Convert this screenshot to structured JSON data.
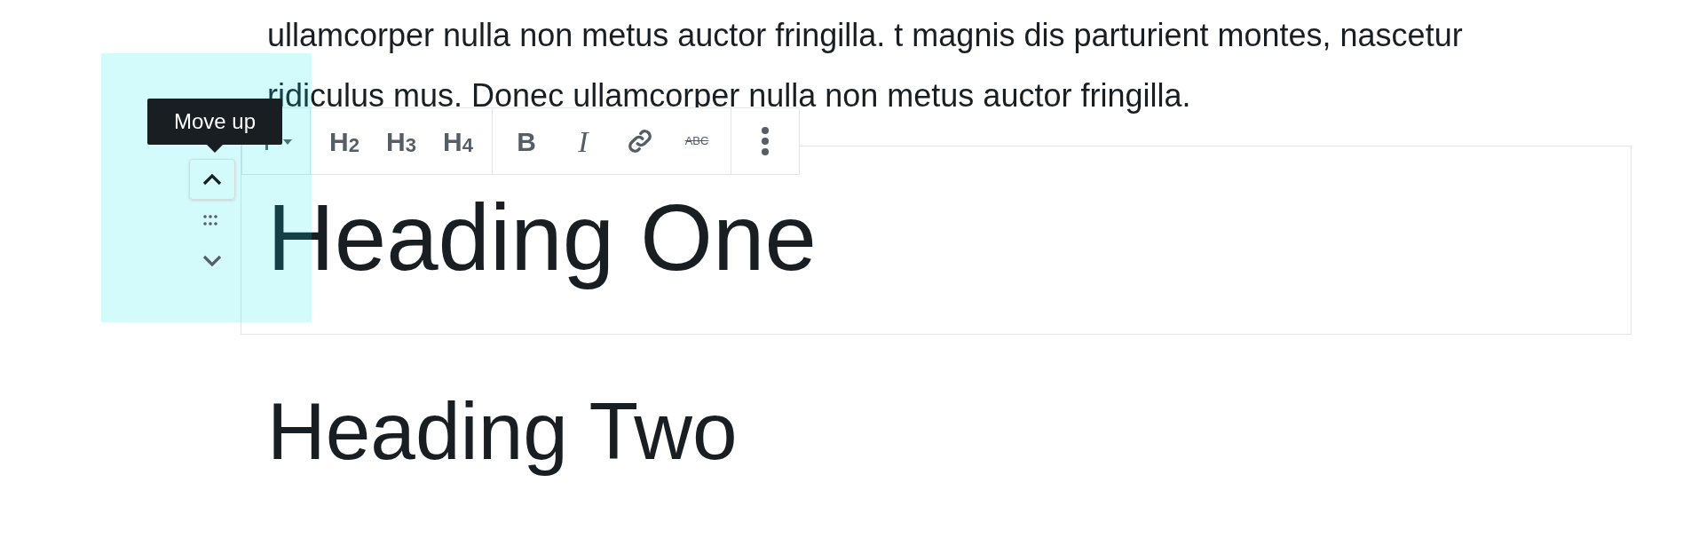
{
  "paragraph": {
    "lines": [
      "ullamcorper nulla non metus auctor fringilla. t magnis dis parturient montes, nascetur",
      "ridiculus mus. Donec ullamcorper nulla non metus auctor fringilla."
    ]
  },
  "block_mover": {
    "tooltip": "Move up",
    "controls": [
      {
        "kind": "up"
      },
      {
        "kind": "drag"
      },
      {
        "kind": "down"
      }
    ]
  },
  "toolbar": {
    "groups": [
      [
        {
          "kind": "paragraph"
        }
      ],
      [
        {
          "kind": "heading",
          "label": "H",
          "level_label": "2"
        },
        {
          "kind": "heading",
          "label": "H",
          "level_label": "3"
        },
        {
          "kind": "heading",
          "label": "H",
          "level_label": "4"
        }
      ],
      [
        {
          "kind": "bold",
          "label": "B"
        },
        {
          "kind": "italic",
          "label": "I"
        },
        {
          "kind": "link"
        },
        {
          "kind": "strike",
          "label": "ABC"
        }
      ],
      [
        {
          "kind": "more"
        }
      ]
    ]
  },
  "headings": [
    {
      "text": "Heading One",
      "selected": true
    },
    {
      "text": "Heading Two",
      "selected": false
    }
  ]
}
